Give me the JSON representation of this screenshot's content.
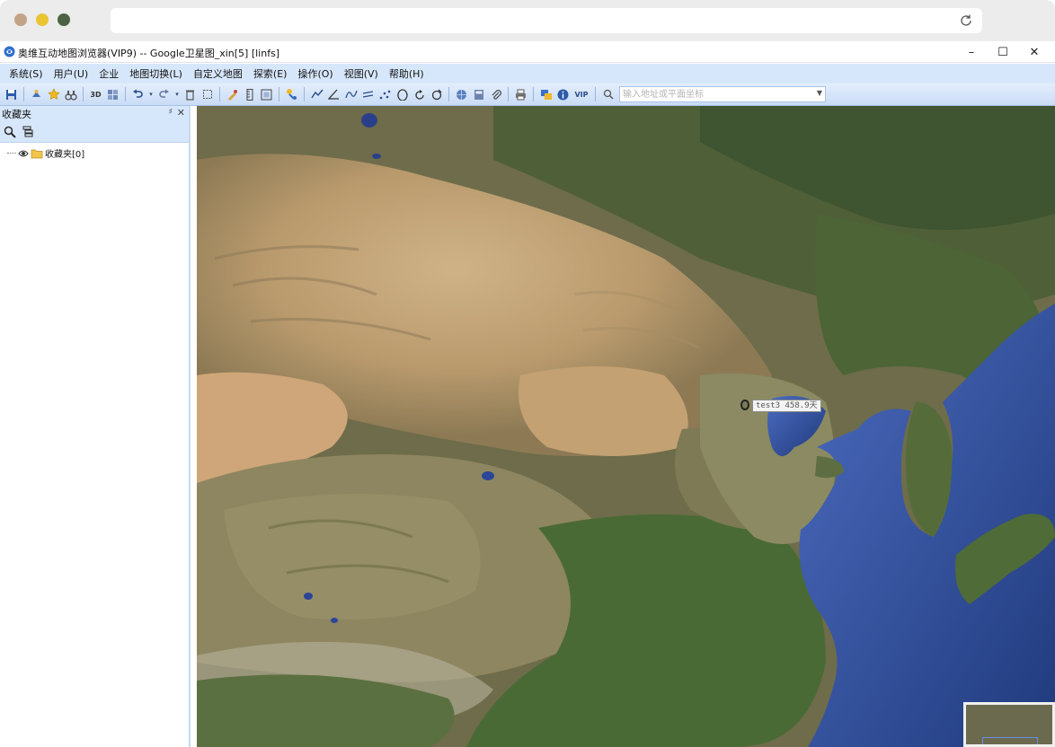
{
  "app": {
    "title": "奥维互动地图浏览器(VIP9) -- Google卫星图_xin[5] [linfs]"
  },
  "window_controls": {
    "minimize": "–",
    "maximize": "☐",
    "close": "✕"
  },
  "menu": {
    "items": [
      "系统(S)",
      "用户(U)",
      "企业",
      "地图切换(L)",
      "自定义地图",
      "探索(E)",
      "操作(O)",
      "视图(V)",
      "帮助(H)"
    ]
  },
  "toolbar": {
    "btn_3d": "3D",
    "btn_vip": "VIP",
    "search_placeholder": "输入地址或平面坐标"
  },
  "sidebar": {
    "title": "收藏夹",
    "pin": "♯",
    "close": "✕",
    "tree": {
      "root_label": "收藏夹[0]"
    }
  },
  "map": {
    "label_text": "test3 458.9天",
    "colors": {
      "desert": "#c7a87e",
      "sea": "#3f5fb0",
      "deep_sea": "#243f82",
      "forest": "#4a5f33",
      "plateau": "#8a7f5c"
    }
  }
}
